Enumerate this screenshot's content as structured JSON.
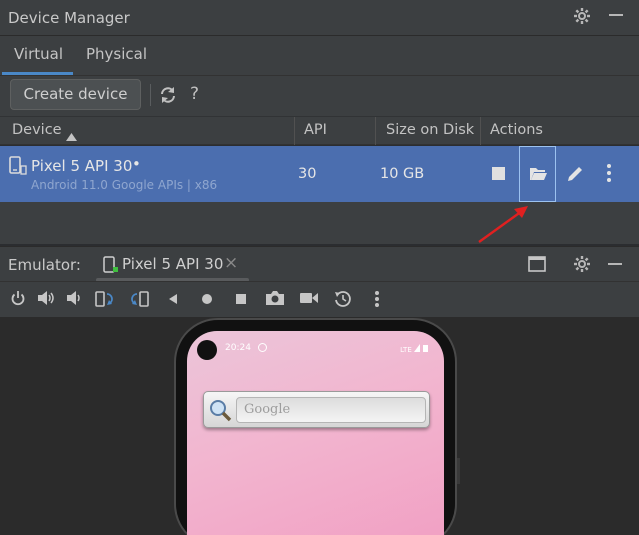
{
  "window": {
    "title": "Device Manager"
  },
  "tabs": [
    {
      "label": "Virtual",
      "active": true
    },
    {
      "label": "Physical",
      "active": false
    }
  ],
  "toolbar": {
    "create_label": "Create device",
    "refresh_icon": "refresh-icon",
    "help_label": "?"
  },
  "table": {
    "headers": {
      "device": "Device",
      "api": "API",
      "size": "Size on Disk",
      "actions": "Actions"
    },
    "sort": "ascending",
    "rows": [
      {
        "name": "Pixel 5 API 30",
        "running_dot": "•",
        "details": "Android 11.0 Google APIs | x86",
        "api": "30",
        "size": "10 GB"
      }
    ]
  },
  "emulator": {
    "label": "Emulator:",
    "tab_label": "Pixel 5 API 30",
    "close_glyph": "×"
  },
  "phone": {
    "time": "20:24",
    "signal": "LTE",
    "search_placeholder": "Google"
  },
  "colors": {
    "selection": "#4b6eaf",
    "accent": "#4a88c7",
    "arrow": "#e02020"
  }
}
